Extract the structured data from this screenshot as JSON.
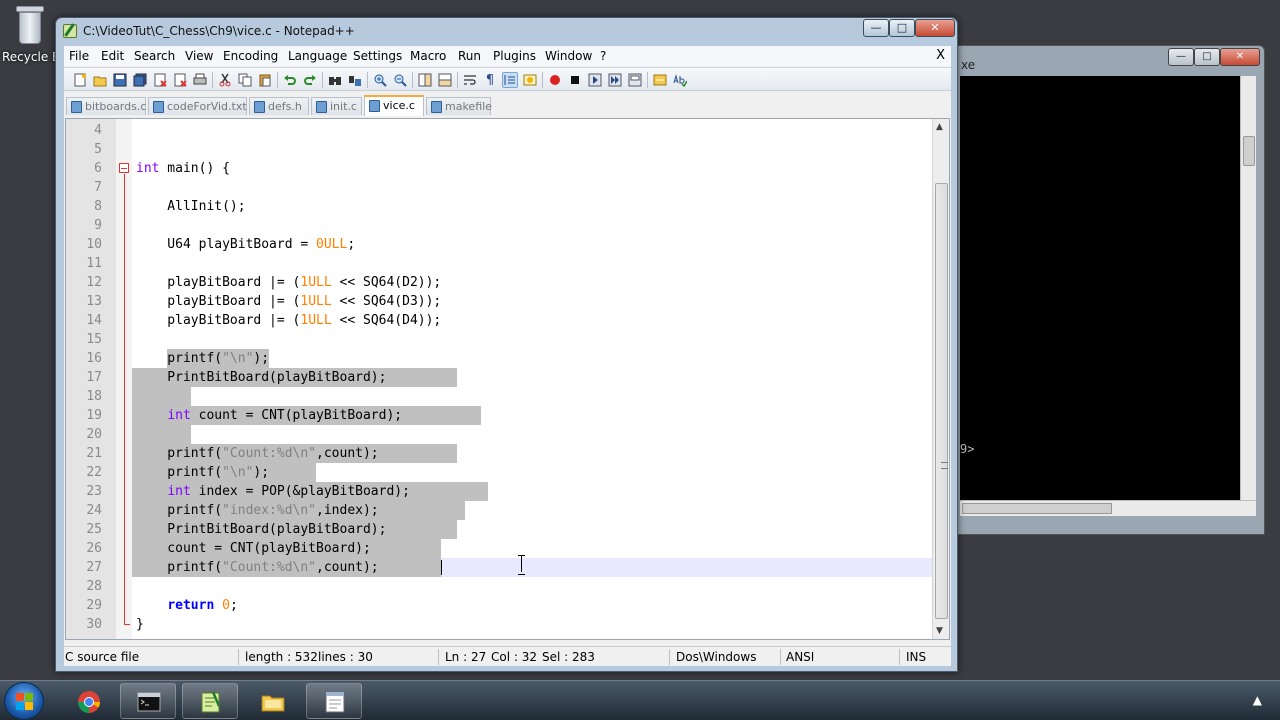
{
  "desktop": {
    "recycle_label": "Recycle B"
  },
  "console": {
    "title_fragment": "xe",
    "prompt_fragment": "9>",
    "btn_min": "—",
    "btn_max": "□",
    "btn_close": "✕"
  },
  "window": {
    "title": "C:\\VideoTut\\C_Chess\\Ch9\\vice.c - Notepad++",
    "btn_min": "—",
    "btn_max": "□",
    "btn_close": "✕"
  },
  "menu": {
    "items": [
      "File",
      "Edit",
      "Search",
      "View",
      "Encoding",
      "Language",
      "Settings",
      "Macro",
      "Run",
      "Plugins",
      "Window",
      "?"
    ],
    "close": "X"
  },
  "toolbar": {
    "icons": [
      "new-file",
      "open-file",
      "save",
      "save-all",
      "close",
      "close-all",
      "print",
      "cut",
      "copy",
      "paste",
      "undo",
      "redo",
      "find",
      "replace",
      "zoom-in",
      "zoom-out",
      "sync-vertical",
      "sync-horizontal",
      "word-wrap",
      "show-all-chars",
      "indent-guide",
      "user-defined-lang",
      "record-macro",
      "stop-record",
      "play-macro",
      "run-macro-multiple",
      "save-macro",
      "launch-browser",
      "spell-check"
    ]
  },
  "tabs": [
    {
      "label": "bitboards.c",
      "active": false
    },
    {
      "label": "codeForVid.txt",
      "active": false
    },
    {
      "label": "defs.h",
      "active": false
    },
    {
      "label": "init.c",
      "active": false
    },
    {
      "label": "vice.c",
      "active": true
    },
    {
      "label": "makefile",
      "active": false
    }
  ],
  "code": {
    "lines": [
      {
        "num": "4",
        "tokens": []
      },
      {
        "num": "5",
        "tokens": []
      },
      {
        "num": "6",
        "tokens": [
          [
            "type",
            "int"
          ],
          [
            "plain",
            " main() {"
          ]
        ]
      },
      {
        "num": "7",
        "tokens": []
      },
      {
        "num": "8",
        "tokens": [
          [
            "plain",
            "    AllInit();"
          ]
        ]
      },
      {
        "num": "9",
        "tokens": []
      },
      {
        "num": "10",
        "tokens": [
          [
            "plain",
            "    U64 playBitBoard = "
          ],
          [
            "num",
            "0ULL"
          ],
          [
            "plain",
            ";"
          ]
        ]
      },
      {
        "num": "11",
        "tokens": []
      },
      {
        "num": "12",
        "tokens": [
          [
            "plain",
            "    playBitBoard |= ("
          ],
          [
            "num",
            "1ULL"
          ],
          [
            "plain",
            " << SQ64(D2));"
          ]
        ]
      },
      {
        "num": "13",
        "tokens": [
          [
            "plain",
            "    playBitBoard |= ("
          ],
          [
            "num",
            "1ULL"
          ],
          [
            "plain",
            " << SQ64(D3));"
          ]
        ]
      },
      {
        "num": "14",
        "tokens": [
          [
            "plain",
            "    playBitBoard |= ("
          ],
          [
            "num",
            "1ULL"
          ],
          [
            "plain",
            " << SQ64(D4));"
          ]
        ]
      },
      {
        "num": "15",
        "tokens": []
      },
      {
        "num": "16",
        "tokens": [
          [
            "plain",
            "    printf("
          ],
          [
            "str",
            "\"\\n\""
          ],
          [
            "plain",
            ");"
          ]
        ]
      },
      {
        "num": "17",
        "tokens": [
          [
            "plain",
            "    PrintBitBoard(playBitBoard);"
          ]
        ]
      },
      {
        "num": "18",
        "tokens": []
      },
      {
        "num": "19",
        "tokens": [
          [
            "plain",
            "    "
          ],
          [
            "type",
            "int"
          ],
          [
            "plain",
            " count = CNT(playBitBoard);"
          ]
        ]
      },
      {
        "num": "20",
        "tokens": []
      },
      {
        "num": "21",
        "tokens": [
          [
            "plain",
            "    printf("
          ],
          [
            "str",
            "\"Count:%d\\n\""
          ],
          [
            "plain",
            ",count);"
          ]
        ]
      },
      {
        "num": "22",
        "tokens": [
          [
            "plain",
            "    printf("
          ],
          [
            "str",
            "\"\\n\""
          ],
          [
            "plain",
            ");"
          ]
        ]
      },
      {
        "num": "23",
        "tokens": [
          [
            "plain",
            "    "
          ],
          [
            "type",
            "int"
          ],
          [
            "plain",
            " index = POP(&playBitBoard);"
          ]
        ]
      },
      {
        "num": "24",
        "tokens": [
          [
            "plain",
            "    printf("
          ],
          [
            "str",
            "\"index:%d\\n\""
          ],
          [
            "plain",
            ",index);"
          ]
        ]
      },
      {
        "num": "25",
        "tokens": [
          [
            "plain",
            "    PrintBitBoard(playBitBoard);"
          ]
        ]
      },
      {
        "num": "26",
        "tokens": [
          [
            "plain",
            "    count = CNT(playBitBoard);"
          ]
        ]
      },
      {
        "num": "27",
        "tokens": [
          [
            "plain",
            "    printf("
          ],
          [
            "str",
            "\"Count:%d\\n\""
          ],
          [
            "plain",
            ",count);"
          ]
        ]
      },
      {
        "num": "28",
        "tokens": []
      },
      {
        "num": "29",
        "tokens": [
          [
            "plain",
            "    "
          ],
          [
            "ret",
            "return"
          ],
          [
            "plain",
            " "
          ],
          [
            "num",
            "0"
          ],
          [
            "plain",
            ";"
          ]
        ]
      },
      {
        "num": "30",
        "tokens": [
          [
            "plain",
            "}"
          ]
        ]
      }
    ]
  },
  "status": {
    "file_type": "C source file",
    "length": "length : 532",
    "lines": "lines : 30",
    "ln": "Ln : 27",
    "col": "Col : 32",
    "sel": "Sel : 283",
    "eol": "Dos\\Windows",
    "encoding": "ANSI",
    "mode": "INS"
  },
  "colors": {
    "keyword_type": "#8000ff",
    "keyword_return": "#0000ff",
    "number": "#ff8000",
    "string": "#808080",
    "selection": "#c0c0c0",
    "fold_marker": "#e23333",
    "active_tab_accent": "#f7a93b"
  },
  "taskbar": {
    "items": [
      "start-button",
      "chrome-icon",
      "command-prompt-icon",
      "notepadpp-icon",
      "file-explorer-icon",
      "window-preview-icon"
    ]
  }
}
